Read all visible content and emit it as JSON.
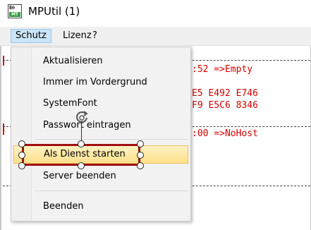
{
  "window": {
    "title": "MPUtil (1)",
    "icon": "mpmt-app-icon",
    "icon_top_text": "E⊖",
    "icon_bottom_text": "MT"
  },
  "menubar": {
    "items": [
      {
        "label": "Schutz",
        "active": true
      },
      {
        "label": "Lizenz"
      },
      {
        "label": "?"
      }
    ]
  },
  "console": {
    "lines": [
      ":52 =>Empty",
      "E5 E492 E746",
      "F9 E5C6 8346",
      ":00 =>NoHost"
    ],
    "text_color": "#d40000"
  },
  "dropdown": {
    "items": [
      {
        "label": "Aktualisieren"
      },
      {
        "label": "Immer im Vordergrund"
      },
      {
        "label": "SystemFont"
      },
      {
        "label": "Passwort eintragen"
      },
      {
        "label": "Als Dienst starten",
        "highlighted": true
      },
      {
        "label": "Server beenden"
      },
      {
        "label": "Beenden"
      }
    ],
    "highlight_color": "#ffe08a"
  },
  "annotation": {
    "box_color": "#a01010",
    "rotate_icon": "rotate-icon"
  }
}
